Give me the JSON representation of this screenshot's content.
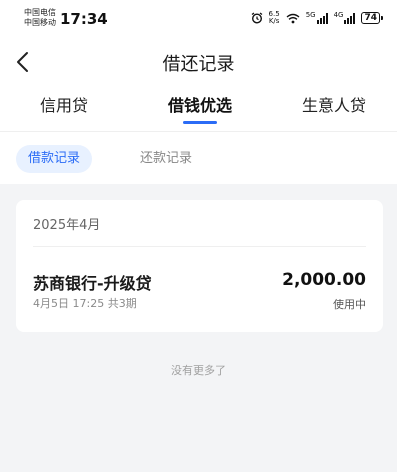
{
  "status_bar": {
    "carrier_1": "中国电信",
    "carrier_2": "中国移动",
    "time": "17:34",
    "speed_value": "6.5",
    "speed_unit": "K/s",
    "net_1": "5G",
    "net_2": "4G",
    "battery": "74"
  },
  "header": {
    "title": "借还记录"
  },
  "tabs": [
    {
      "label": "信用贷",
      "active": false
    },
    {
      "label": "借钱优选",
      "active": true
    },
    {
      "label": "生意人贷",
      "active": false
    }
  ],
  "subtabs": [
    {
      "label": "借款记录",
      "active": true
    },
    {
      "label": "还款记录",
      "active": false
    }
  ],
  "records": {
    "month": "2025年4月",
    "items": [
      {
        "name": "苏商银行-升级贷",
        "meta": "4月5日 17:25 共3期",
        "amount": "2,000.00",
        "status": "使用中"
      }
    ]
  },
  "footer": {
    "no_more": "没有更多了"
  },
  "colors": {
    "accent": "#2b6cf6",
    "pill_bg": "#e8f1ff",
    "page_bg": "#f3f4f6"
  }
}
